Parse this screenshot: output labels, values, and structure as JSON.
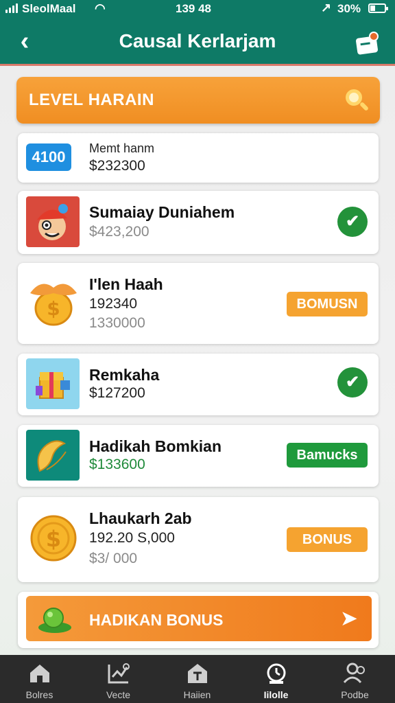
{
  "status_bar": {
    "carrier": "SleolMaal",
    "time": "139 48",
    "battery": "30%"
  },
  "header": {
    "title": "Causal Kerlarjam",
    "back_icon": "chevron-left-icon",
    "action_icon": "edit-document-icon",
    "colors": {
      "bar": "#0e7a66",
      "accent": "#f08e22"
    }
  },
  "level_banner": {
    "label": "LEVEL HARAIN",
    "icon": "search-icon"
  },
  "items": [
    {
      "badge": "4100",
      "title": "Memt hanm",
      "line2": "$232300"
    },
    {
      "title": "Sumaiay Duniahem",
      "line2": "$423,200",
      "status": "check-icon"
    },
    {
      "title": "I'len Haah",
      "line2": "192340",
      "line3": "1330000",
      "action": "BOMUSN"
    },
    {
      "title": "Remkaha",
      "line2": "$127200",
      "status": "check-icon"
    },
    {
      "title": "Hadikah Bomkian",
      "line2": "$133600",
      "action": "Bamucks"
    },
    {
      "title": "Lhaukarh 2ab",
      "line2": "192.20 S,000",
      "line3": "$3/ 000",
      "action": "BONUS"
    }
  ],
  "bonus_banner": {
    "label": "HADIKAN BONUS",
    "icon": "arrow-right-icon"
  },
  "bottom_nav": [
    {
      "label": "Bolres",
      "icon": "home-icon"
    },
    {
      "label": "Vecte",
      "icon": "chart-check-icon"
    },
    {
      "label": "Haiien",
      "icon": "house-t-icon"
    },
    {
      "label": "Iilolle",
      "icon": "timer-icon",
      "active": true
    },
    {
      "label": "Podbe",
      "icon": "people-icon"
    }
  ]
}
